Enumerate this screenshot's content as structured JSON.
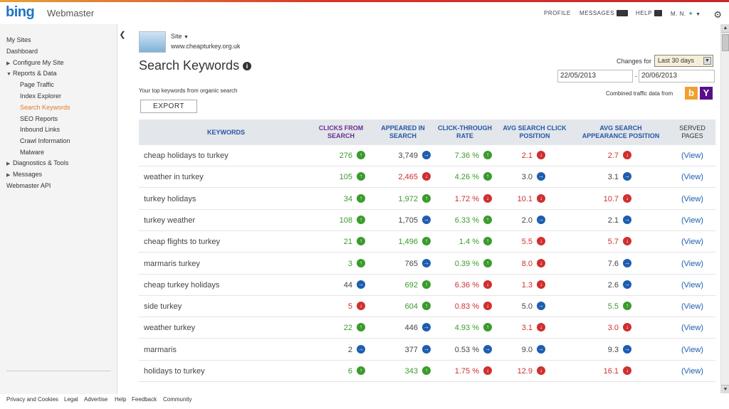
{
  "brand": {
    "logo": "bing",
    "product": "Webmaster"
  },
  "topnav": {
    "profile": "PROFILE",
    "messages": "MESSAGES",
    "messages_count": "10",
    "help": "HELP",
    "help_badge": "?",
    "user": "M. N.",
    "settings_icon": "gear-icon"
  },
  "sidebar": {
    "items": [
      {
        "label": "My Sites"
      },
      {
        "label": "Dashboard"
      },
      {
        "label": "Configure My Site"
      },
      {
        "label": "Reports & Data"
      },
      {
        "label": "Page Traffic"
      },
      {
        "label": "Index Explorer"
      },
      {
        "label": "Search Keywords"
      },
      {
        "label": "SEO Reports"
      },
      {
        "label": "Inbound Links"
      },
      {
        "label": "Crawl Information"
      },
      {
        "label": "Malware"
      },
      {
        "label": "Diagnostics & Tools"
      },
      {
        "label": "Messages"
      },
      {
        "label": "Webmaster API"
      }
    ]
  },
  "site": {
    "label": "Site",
    "url": "www.cheapturkey.org.uk"
  },
  "page": {
    "title": "Search Keywords",
    "subtitle": "Your top keywords from organic search",
    "export_label": "EXPORT"
  },
  "filters": {
    "changes_label": "Changes for",
    "changes_value": "Last 30 days",
    "date_from": "22/05/2013",
    "date_sep": "-",
    "date_to": "20/06/2013",
    "combined_label": "Combined traffic data from",
    "bing_glyph": "b",
    "yahoo_glyph": "Y"
  },
  "table": {
    "headers": {
      "keywords": "KEYWORDS",
      "clicks_1": "CLICKS FROM",
      "clicks_2": "SEARCH",
      "appeared_1": "APPEARED IN",
      "appeared_2": "SEARCH",
      "ctr_1": "CLICK-THROUGH",
      "ctr_2": "RATE",
      "click_pos_1": "AVG SEARCH CLICK",
      "click_pos_2": "POSITION",
      "appear_pos_1": "AVG SEARCH",
      "appear_pos_2": "APPEARANCE POSITION",
      "served_1": "SERVED",
      "served_2": "PAGES"
    },
    "view_label": "(View)",
    "rows": [
      {
        "keyword": "cheap holidays to turkey",
        "clicks": "276",
        "clicks_t": "up",
        "appeared": "3,749",
        "appeared_t": "right",
        "ctr": "7.36 %",
        "ctr_t": "up",
        "click_pos": "2.1",
        "click_pos_t": "down",
        "appear_pos": "2.7",
        "appear_pos_t": "down"
      },
      {
        "keyword": "weather in turkey",
        "clicks": "105",
        "clicks_t": "up",
        "appeared": "2,465",
        "appeared_t": "down",
        "ctr": "4.26 %",
        "ctr_t": "up",
        "click_pos": "3.0",
        "click_pos_t": "right",
        "appear_pos": "3.1",
        "appear_pos_t": "right"
      },
      {
        "keyword": "turkey holidays",
        "clicks": "34",
        "clicks_t": "up",
        "appeared": "1,972",
        "appeared_t": "up",
        "ctr": "1.72 %",
        "ctr_t": "down",
        "click_pos": "10.1",
        "click_pos_t": "down",
        "appear_pos": "10.7",
        "appear_pos_t": "down"
      },
      {
        "keyword": "turkey weather",
        "clicks": "108",
        "clicks_t": "up",
        "appeared": "1,705",
        "appeared_t": "right",
        "ctr": "6.33 %",
        "ctr_t": "up",
        "click_pos": "2.0",
        "click_pos_t": "right",
        "appear_pos": "2.1",
        "appear_pos_t": "right"
      },
      {
        "keyword": "cheap flights to turkey",
        "clicks": "21",
        "clicks_t": "up",
        "appeared": "1,496",
        "appeared_t": "up",
        "ctr": "1.4 %",
        "ctr_t": "up",
        "click_pos": "5.5",
        "click_pos_t": "down",
        "appear_pos": "5.7",
        "appear_pos_t": "down"
      },
      {
        "keyword": "marmaris turkey",
        "clicks": "3",
        "clicks_t": "up",
        "appeared": "765",
        "appeared_t": "right",
        "ctr": "0.39 %",
        "ctr_t": "up",
        "click_pos": "8.0",
        "click_pos_t": "down",
        "appear_pos": "7.6",
        "appear_pos_t": "right"
      },
      {
        "keyword": "cheap turkey holidays",
        "clicks": "44",
        "clicks_t": "right",
        "appeared": "692",
        "appeared_t": "up",
        "ctr": "6.36 %",
        "ctr_t": "down",
        "click_pos": "1.3",
        "click_pos_t": "down",
        "appear_pos": "2.6",
        "appear_pos_t": "right"
      },
      {
        "keyword": "side turkey",
        "clicks": "5",
        "clicks_t": "down",
        "appeared": "604",
        "appeared_t": "up",
        "ctr": "0.83 %",
        "ctr_t": "down",
        "click_pos": "5.0",
        "click_pos_t": "right",
        "appear_pos": "5.5",
        "appear_pos_t": "up"
      },
      {
        "keyword": "weather turkey",
        "clicks": "22",
        "clicks_t": "up",
        "appeared": "446",
        "appeared_t": "right",
        "ctr": "4.93 %",
        "ctr_t": "up",
        "click_pos": "3.1",
        "click_pos_t": "down",
        "appear_pos": "3.0",
        "appear_pos_t": "down"
      },
      {
        "keyword": "marmaris",
        "clicks": "2",
        "clicks_t": "right",
        "appeared": "377",
        "appeared_t": "right",
        "ctr": "0.53 %",
        "ctr_t": "right",
        "click_pos": "9.0",
        "click_pos_t": "right",
        "appear_pos": "9.3",
        "appear_pos_t": "right"
      },
      {
        "keyword": "holidays to turkey",
        "clicks": "6",
        "clicks_t": "up",
        "appeared": "343",
        "appeared_t": "up",
        "ctr": "1.75 %",
        "ctr_t": "down",
        "click_pos": "12.9",
        "click_pos_t": "down",
        "appear_pos": "16.1",
        "appear_pos_t": "down"
      }
    ]
  },
  "footer": {
    "links": [
      "Privacy and Cookies",
      "Legal",
      "Advertise",
      "Help",
      "Feedback",
      "Community"
    ]
  },
  "colors": {
    "up": "#3a9b2c",
    "down": "#d02f2f",
    "right": "#1e5db0",
    "active_nav": "#e37b2c"
  }
}
